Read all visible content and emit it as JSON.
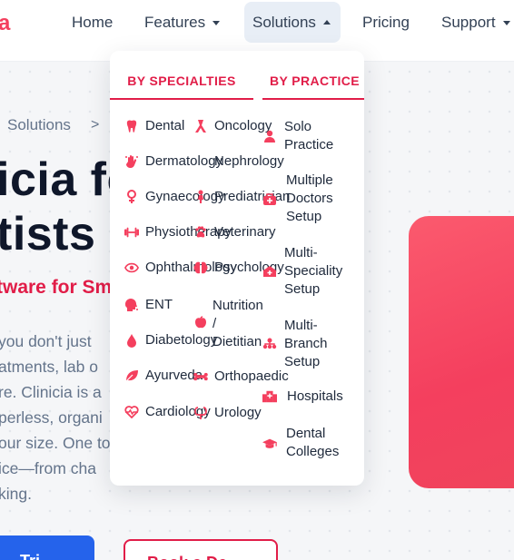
{
  "brand": {
    "logo_fragment": "a"
  },
  "nav": {
    "home": "Home",
    "features": "Features",
    "solutions": "Solutions",
    "pricing": "Pricing",
    "support": "Support"
  },
  "hero": {
    "breadcrumb": "Solutions",
    "breadcrumb_sep": ">",
    "title_line1": "icia fo",
    "title_line2": "tists",
    "subtitle": "tware for Sm",
    "body_lines": [
      "you don't just",
      "atments, lab o",
      "re. Clinicia is a",
      "perless, organi",
      "our size. One to",
      "ice—from cha",
      "king."
    ],
    "trial_button": "Tri",
    "demo_button": "Book a De"
  },
  "menu": {
    "tabs": [
      "BY SPECIALTIES",
      "BY PRACTICE"
    ],
    "specialties": [
      {
        "label": "Dental",
        "icon": "tooth-icon"
      },
      {
        "label": "Dermatology",
        "icon": "hand-icon"
      },
      {
        "label": "Gynaecology",
        "icon": "female-icon"
      },
      {
        "label": "Physiotherapy",
        "icon": "dumbbell-icon"
      },
      {
        "label": "Ophthalmology",
        "icon": "eye-icon"
      },
      {
        "label": "ENT",
        "icon": "head-icon"
      },
      {
        "label": "Diabetology",
        "icon": "drop-icon"
      },
      {
        "label": "Ayurveda",
        "icon": "leaf-icon"
      },
      {
        "label": "Cardiology",
        "icon": "heartbeat-icon"
      }
    ],
    "specialties_col2": [
      {
        "label": "Oncology",
        "icon": "ribbon-icon"
      },
      {
        "label": "Nephrology",
        "icon": "kidney-icon"
      },
      {
        "label": "Prediatrician",
        "icon": "baby-icon"
      },
      {
        "label": "Veterinary",
        "icon": "paw-icon"
      },
      {
        "label": "Psychology",
        "icon": "brain-icon"
      },
      {
        "label_lines": [
          "Nutrition",
          "/",
          "Dietitian"
        ],
        "icon": "apple-icon"
      },
      {
        "label": "Orthopaedic",
        "icon": "bone-icon"
      },
      {
        "label": "Urology",
        "icon": "urology-icon"
      }
    ],
    "practice": [
      {
        "label_lines": [
          "Solo",
          "Practice"
        ],
        "icon": "user-icon"
      },
      {
        "label_lines": [
          "Multiple",
          "Doctors",
          "Setup"
        ],
        "icon": "doctors-icon"
      },
      {
        "label_lines": [
          "Multi-",
          "Speciality",
          "Setup"
        ],
        "icon": "medkit-icon"
      },
      {
        "label_lines": [
          "Multi-",
          "Branch",
          "Setup"
        ],
        "icon": "sitemap-icon"
      },
      {
        "label": "Hospitals",
        "icon": "hospital-icon"
      },
      {
        "label_lines": [
          "Dental",
          "Colleges"
        ],
        "icon": "graduation-cap-icon"
      }
    ]
  },
  "colors": {
    "accent": "#e11d48",
    "icon": "#f43f5e",
    "nav_active_bg": "#e8eef6",
    "cta_blue": "#2563eb"
  }
}
